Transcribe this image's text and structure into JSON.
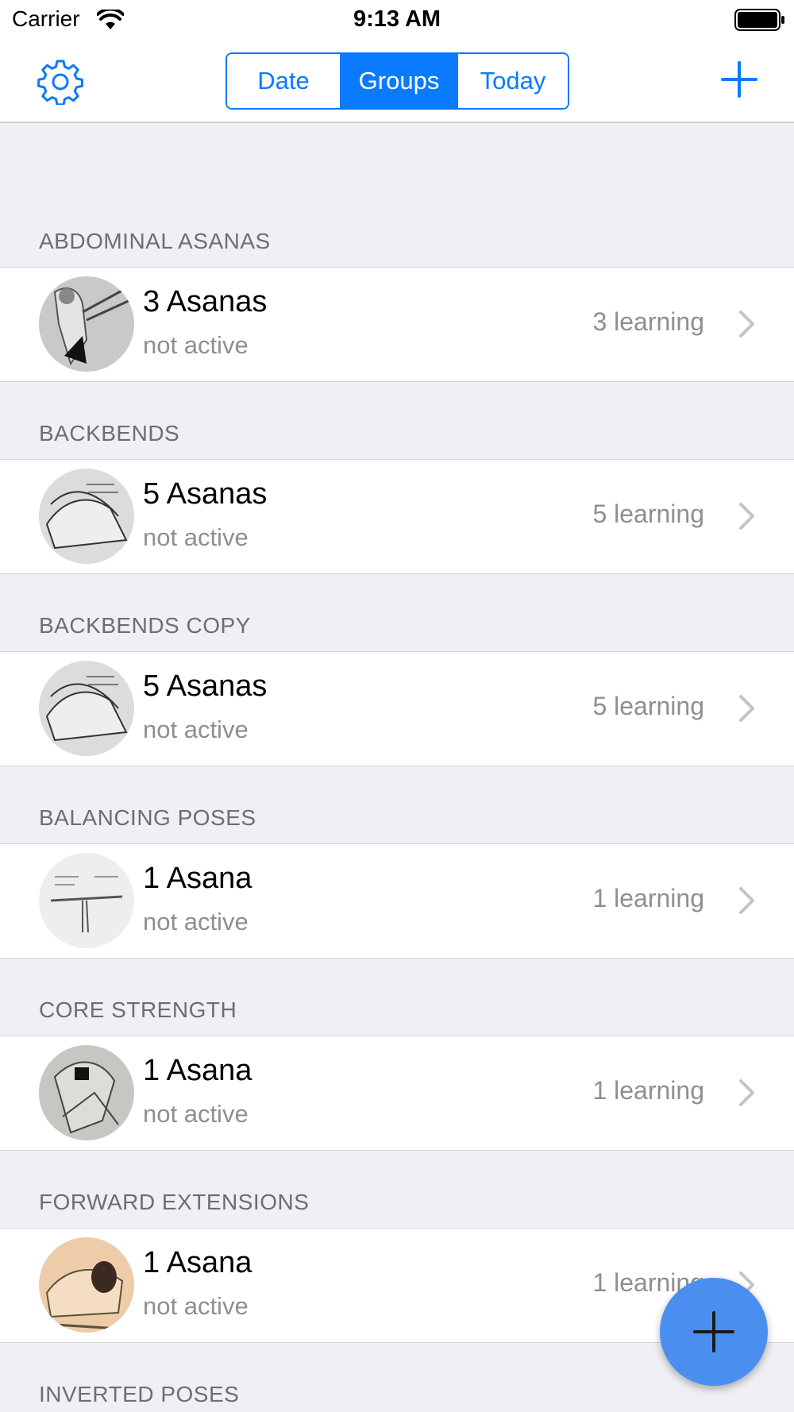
{
  "status_bar": {
    "carrier": "Carrier",
    "time": "9:13 AM"
  },
  "nav": {
    "segments": [
      "Date",
      "Groups",
      "Today"
    ],
    "selected_segment": "Groups"
  },
  "colors": {
    "accent": "#0a7aff",
    "fab": "#4a8ff0",
    "background": "#efeff4",
    "secondary_text": "#8e8e93",
    "section_text": "#6d6d72"
  },
  "groups": [
    {
      "header": "ABDOMINAL ASANAS",
      "title": "3 Asanas",
      "subtitle": "not active",
      "detail": "3 learning"
    },
    {
      "header": "BACKBENDS",
      "title": "5 Asanas",
      "subtitle": "not active",
      "detail": "5 learning"
    },
    {
      "header": "BACKBENDS COPY",
      "title": "5 Asanas",
      "subtitle": "not active",
      "detail": "5 learning"
    },
    {
      "header": "BALANCING POSES",
      "title": "1 Asana",
      "subtitle": "not active",
      "detail": "1 learning"
    },
    {
      "header": "CORE STRENGTH",
      "title": "1 Asana",
      "subtitle": "not active",
      "detail": "1 learning"
    },
    {
      "header": "FORWARD EXTENSIONS",
      "title": "1 Asana",
      "subtitle": "not active",
      "detail": "1 learning"
    },
    {
      "header": "INVERTED POSES"
    }
  ],
  "icons": {
    "settings": "gear-icon",
    "add": "plus-icon",
    "disclosure": "chevron-right-icon",
    "fab": "plus-icon"
  }
}
